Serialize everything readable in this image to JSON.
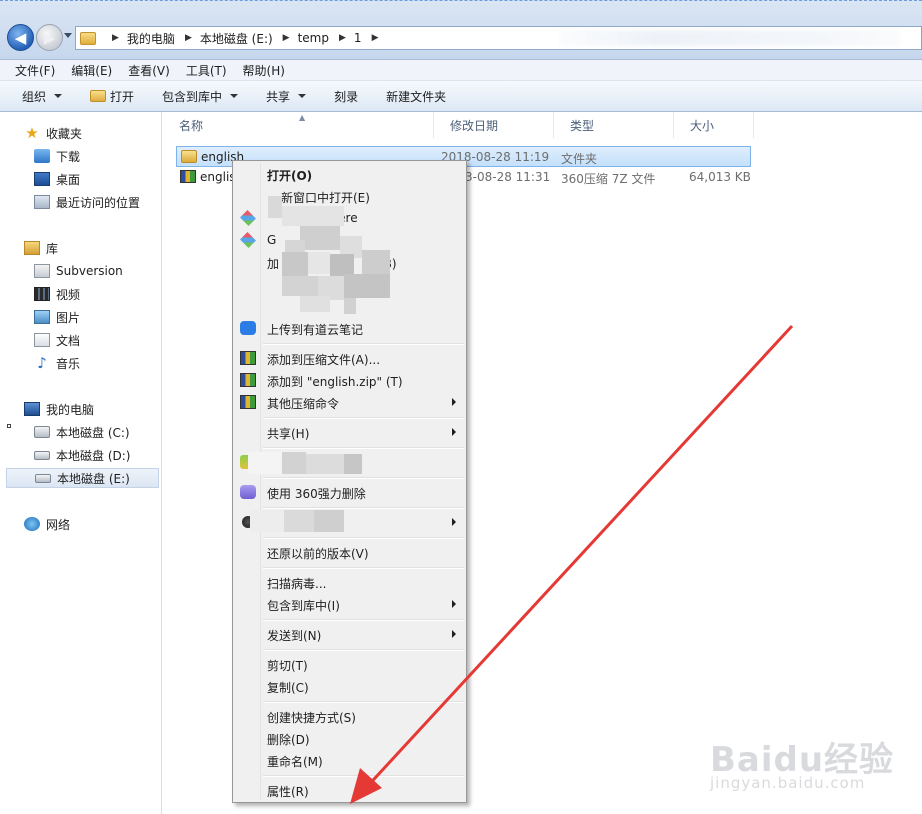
{
  "address": {
    "segments": [
      "我的电脑",
      "本地磁盘 (E:)",
      "temp",
      "1"
    ]
  },
  "menubar": [
    "文件(F)",
    "编辑(E)",
    "查看(V)",
    "工具(T)",
    "帮助(H)"
  ],
  "toolbar": {
    "organize": "组织",
    "open": "打开",
    "include_library": "包含到库中",
    "share": "共享",
    "burn": "刻录",
    "new_folder": "新建文件夹"
  },
  "navpane": {
    "favorites": "收藏夹",
    "downloads": "下载",
    "desktop": "桌面",
    "recent": "最近访问的位置",
    "libraries": "库",
    "subversion": "Subversion",
    "videos": "视频",
    "pictures": "图片",
    "documents": "文档",
    "music": "音乐",
    "computer": "我的电脑",
    "drive_c": "本地磁盘 (C:)",
    "drive_d": "本地磁盘 (D:)",
    "drive_e": "本地磁盘 (E:)",
    "network": "网络"
  },
  "columns": {
    "name": "名称",
    "modified": "修改日期",
    "type": "类型",
    "size": "大小"
  },
  "files": [
    {
      "name": "english",
      "modified": "2018-08-28 11:19",
      "type": "文件夹",
      "size": "",
      "icon": "folder-icon"
    },
    {
      "name": "englis",
      "modified": "3-08-28 11:31",
      "type": "360压缩 7Z 文件",
      "size": "64,013 KB",
      "icon": "archive-icon"
    }
  ],
  "context_menu": {
    "open": "打开(O)",
    "open_new_window": "新窗口中打开(E)",
    "git_gui": "UI Here",
    "git_prefix": "G",
    "add_prefix": "加",
    "add_suffix": "库(B)",
    "upload_youdao": "上传到有道云笔记",
    "add_archive": "添加到压缩文件(A)...",
    "add_zip": "添加到 \"english.zip\" (T)",
    "other_compress": "其他压缩命令",
    "share": "共享(H)",
    "force_delete_360": "使用 360强力删除",
    "restore_previous": "还原以前的版本(V)",
    "scan_virus": "扫描病毒...",
    "include_library": "包含到库中(I)",
    "send_to": "发送到(N)",
    "cut": "剪切(T)",
    "copy": "复制(C)",
    "create_shortcut": "创建快捷方式(S)",
    "delete": "删除(D)",
    "rename": "重命名(M)",
    "properties": "属性(R)"
  },
  "watermark": {
    "brand": "Baidu经验",
    "url": "jingyan.baidu.com"
  },
  "colors": {
    "arrow": "#e53935",
    "selection": "#c4e0fc",
    "toolbar": "#dde8f5"
  }
}
